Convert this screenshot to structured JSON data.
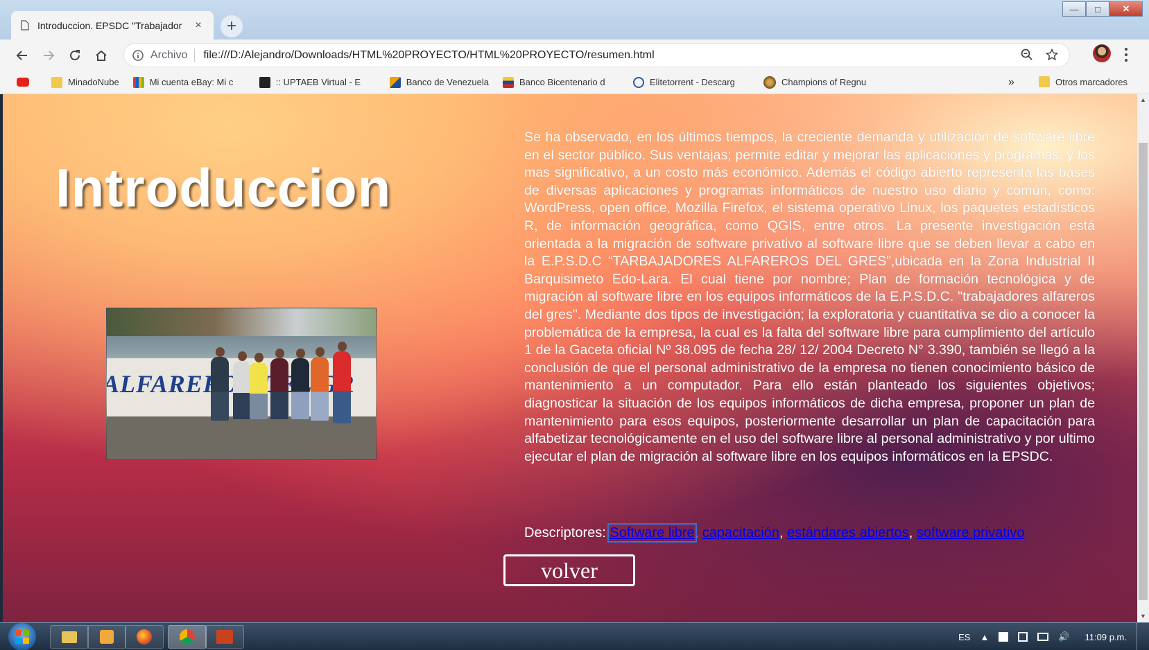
{
  "browser": {
    "tab_title": "Introduccion. EPSDC \"Trabajador",
    "tab_close": "×",
    "new_tab": "+",
    "omnibox": {
      "scheme_label": "Archivo",
      "url": "file:///D:/Alejandro/Downloads/HTML%20PROYECTO/HTML%20PROYECTO/resumen.html"
    },
    "bookmarks": [
      {
        "label": "",
        "icon": "youtube-icon",
        "color": "#e62117"
      },
      {
        "label": "MinadoNube",
        "icon": "folder-icon",
        "color": "#f2c94c"
      },
      {
        "label": "Mi cuenta eBay: Mi c",
        "icon": "ebay-icon",
        "color": "#c8331f"
      },
      {
        "label": ":: UPTAEB Virtual - E",
        "icon": "uptaeb-icon",
        "color": "#222222"
      },
      {
        "label": "Banco de Venezuela",
        "icon": "bank-icon",
        "color": "#e8a20c"
      },
      {
        "label": "Banco Bicentenario d",
        "icon": "bank-flag-icon",
        "color": "#d7261e"
      },
      {
        "label": "Elitetorrent - Descarg",
        "icon": "torrent-icon",
        "color": "#2c5aa0"
      },
      {
        "label": "Champions of Regnu",
        "icon": "game-icon",
        "color": "#6b4b1c"
      }
    ],
    "bookmarks_more": "»",
    "other_bookmarks": "Otros marcadores"
  },
  "page": {
    "heading": "Introduccion",
    "photo_wall_text": "ALFAREROS DEL GR",
    "body": "Se ha observado, en los últimos tiempos, la creciente demanda y utilización de software libre en el sector público. Sus ventajas; permite editar y mejorar las aplicaciones y programas, y los mas significativo, a un costo más económico. Además el código abierto representa las bases de diversas aplicaciones y programas informáticos de nuestro uso diario y común, como: WordPress, open office, Mozilla Firefox, el sistema operativo Linux, los paquetes estadísticos R, de información geográfica, como QGIS, entre otros. La presente investigación está orientada a la migración de software privativo al software libre que se deben llevar a cabo en la E.P.S.D.C “TARBAJADORES ALFAREROS DEL GRES”,ubicada en la Zona Industrial II Barquisimeto Edo-Lara. El cual tiene por nombre; Plan de formación tecnológica y de migración al software libre en los equipos informáticos de la E.P.S.D.C. \"trabajadores alfareros del gres\". Mediante dos tipos de investigación; la exploratoria y cuantitativa se dio a conocer la problemática de la empresa, la cual es la falta del software libre para cumplimiento del artículo 1 de la Gaceta oficial Nº 38.095 de fecha 28/ 12/ 2004 Decreto N° 3.390, también se llegó a la conclusión de que el personal administrativo de la empresa no tienen conocimiento básico de mantenimiento a un computador. Para ello están planteado los siguientes objetivos; diagnosticar la situación de los equipos informáticos de dicha empresa, proponer un plan de mantenimiento para esos equipos, posteriormente desarrollar un plan de capacitación para alfabetizar tecnológicamente en el uso del software libre al personal administrativo y por ultimo ejecutar el plan de migración al software libre en los equipos informáticos en la EPSDC.",
    "descriptores_label": "Descriptores: ",
    "descriptores": [
      "Software libre",
      "capacitación",
      "estándares abiertos",
      "software privativo"
    ],
    "separator": ", ",
    "volver": "volver"
  },
  "taskbar": {
    "language": "ES",
    "clock": "11:09 p.m."
  }
}
